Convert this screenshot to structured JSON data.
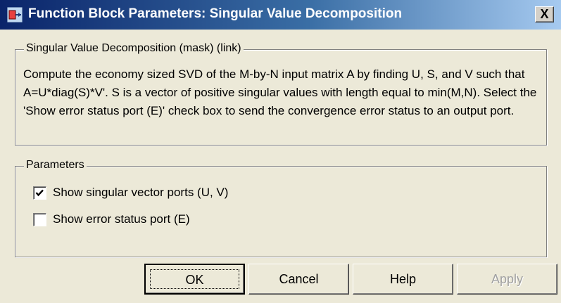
{
  "window": {
    "title": "Function Block Parameters: Singular Value Decomposition",
    "close_label": "X",
    "icon": "simulink-block-icon"
  },
  "description": {
    "legend": "Singular Value Decomposition (mask) (link)",
    "text": "Compute the economy sized SVD of  the M-by-N input matrix A by finding U, S,  and V such that A=U*diag(S)*V'. S is a vector of positive singular values with length equal to min(M,N). Select the 'Show error status port (E)' check box to send the convergence error status to an output port."
  },
  "parameters": {
    "legend": "Parameters",
    "options": [
      {
        "label": "Show singular vector ports (U, V)",
        "checked": true
      },
      {
        "label": "Show error status port (E)",
        "checked": false
      }
    ]
  },
  "buttons": {
    "ok": "OK",
    "cancel": "Cancel",
    "help": "Help",
    "apply": "Apply"
  }
}
